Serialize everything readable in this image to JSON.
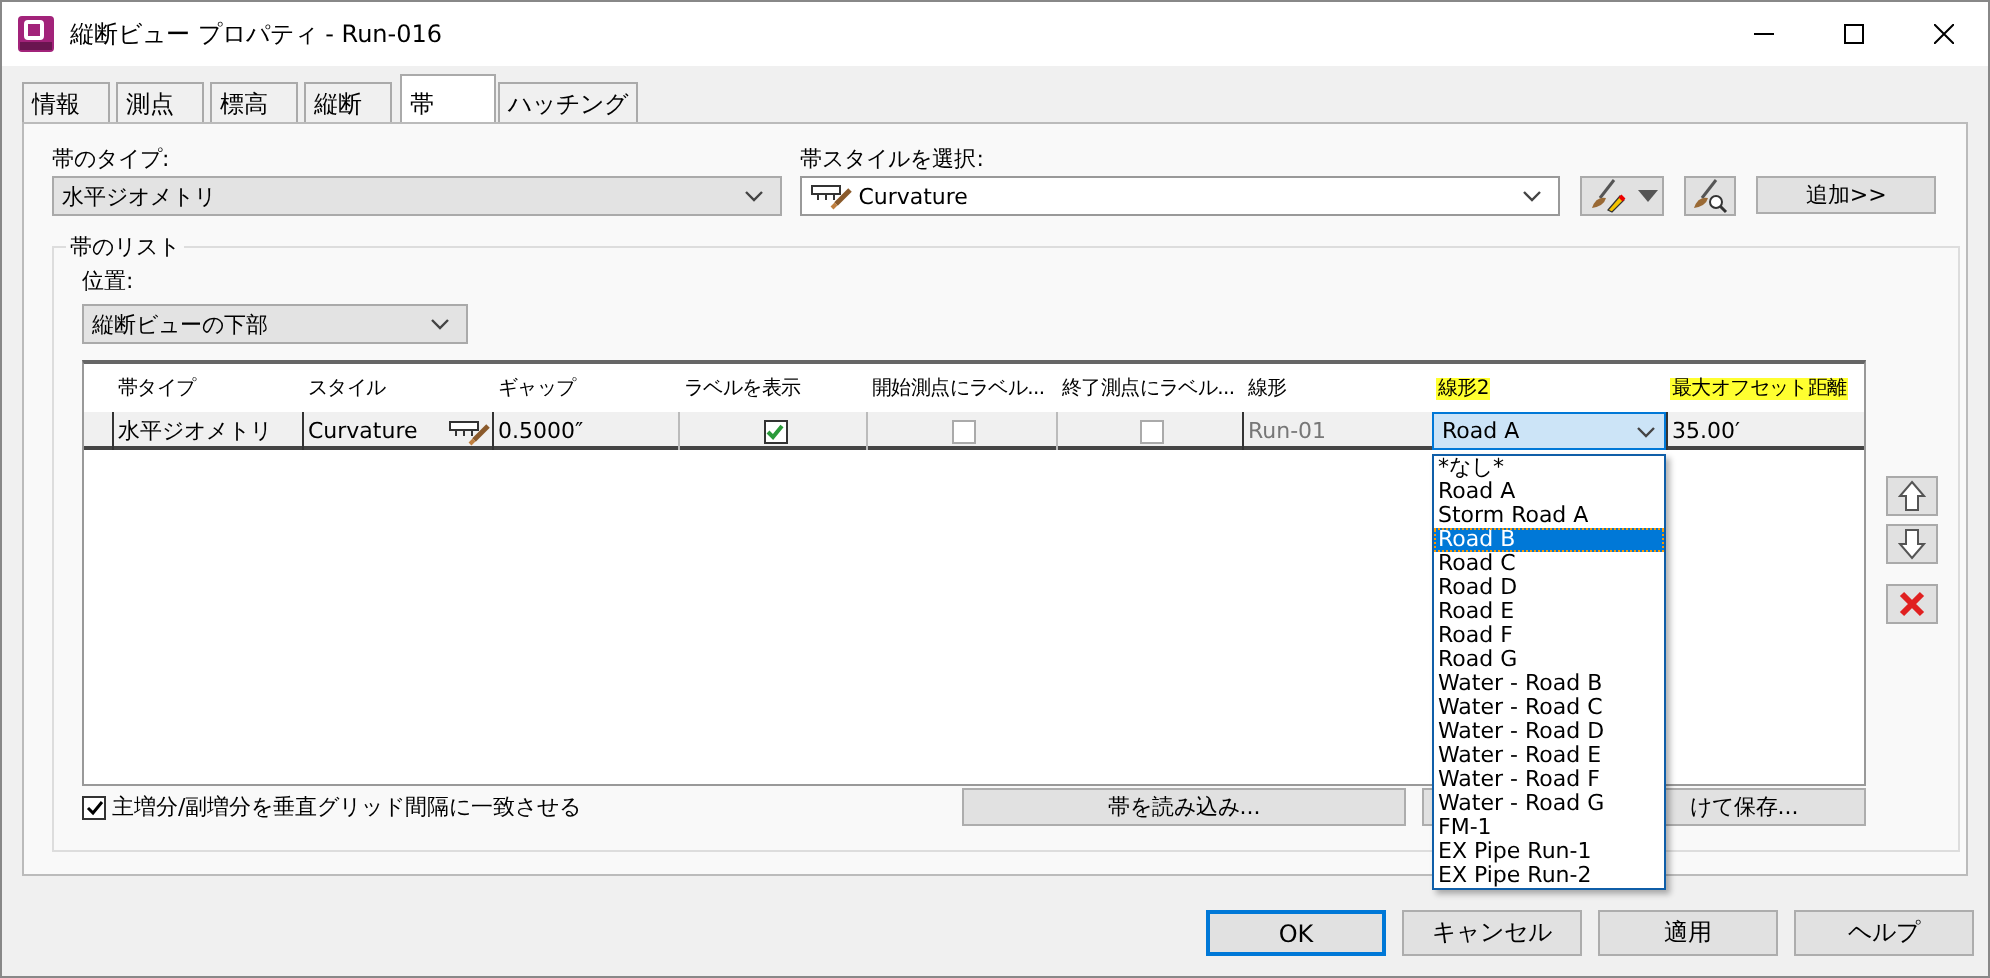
{
  "window": {
    "title": "縦断ビュー プロパティ - Run-016"
  },
  "tabs": [
    {
      "label": "情報",
      "selected": false
    },
    {
      "label": "測点",
      "selected": false
    },
    {
      "label": "標高",
      "selected": false
    },
    {
      "label": "縦断",
      "selected": false
    },
    {
      "label": "帯",
      "selected": true
    },
    {
      "label": "ハッチング",
      "selected": false
    }
  ],
  "band_type": {
    "label": "帯のタイプ:",
    "value": "水平ジオメトリ"
  },
  "band_style": {
    "label": "帯スタイルを選択:",
    "value": "Curvature"
  },
  "add_button": "追加>>",
  "band_list": {
    "title": "帯のリスト",
    "position_label": "位置:",
    "position_value": "縦断ビューの下部",
    "columns": [
      {
        "label": "帯タイプ",
        "highlighted": false
      },
      {
        "label": "スタイル",
        "highlighted": false
      },
      {
        "label": "ギャップ",
        "highlighted": false
      },
      {
        "label": "ラベルを表示",
        "highlighted": false
      },
      {
        "label": "開始測点にラベル...",
        "highlighted": false
      },
      {
        "label": "終了測点にラベル...",
        "highlighted": false
      },
      {
        "label": "線形",
        "highlighted": false
      },
      {
        "label": "線形2",
        "highlighted": true
      },
      {
        "label": "最大オフセット距離",
        "highlighted": true
      }
    ],
    "rows": [
      {
        "band_type": "水平ジオメトリ",
        "style": "Curvature",
        "gap": "0.5000″",
        "show_labels": true,
        "label_start": false,
        "label_end": false,
        "alignment": "Run-01",
        "alignment2": "Road A",
        "max_offset": "35.00′"
      }
    ],
    "dropdown": [
      {
        "label": "*なし*",
        "selected": false
      },
      {
        "label": "Road A",
        "selected": false
      },
      {
        "label": "Storm Road A",
        "selected": false
      },
      {
        "label": "Road B",
        "selected": true
      },
      {
        "label": "Road C",
        "selected": false
      },
      {
        "label": "Road D",
        "selected": false
      },
      {
        "label": "Road E",
        "selected": false
      },
      {
        "label": "Road F",
        "selected": false
      },
      {
        "label": "Road G",
        "selected": false
      },
      {
        "label": "Water - Road B",
        "selected": false
      },
      {
        "label": "Water - Road C",
        "selected": false
      },
      {
        "label": "Water - Road D",
        "selected": false
      },
      {
        "label": "Water - Road E",
        "selected": false
      },
      {
        "label": "Water - Road F",
        "selected": false
      },
      {
        "label": "Water - Road G",
        "selected": false
      },
      {
        "label": "FM-1",
        "selected": false
      },
      {
        "label": "EX Pipe Run-1",
        "selected": false
      },
      {
        "label": "EX Pipe Run-2",
        "selected": false
      }
    ],
    "match_grid": {
      "label": "主増分/副増分を垂直グリッド間隔に一致させる",
      "checked": true
    },
    "import_button": "帯を読み込み...",
    "save_button": "けて保存..."
  },
  "footer_buttons": [
    {
      "label": "OK",
      "default": true
    },
    {
      "label": "キャンセル",
      "default": false
    },
    {
      "label": "適用",
      "default": false
    },
    {
      "label": "ヘルプ",
      "default": false
    }
  ]
}
